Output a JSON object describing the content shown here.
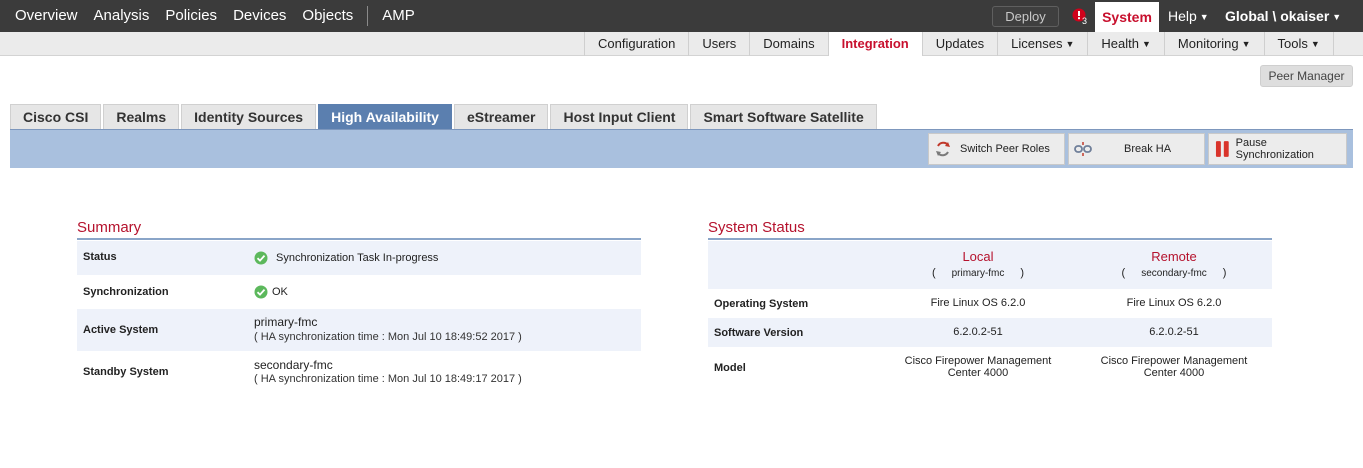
{
  "topnav": {
    "items": [
      "Overview",
      "Analysis",
      "Policies",
      "Devices",
      "Objects",
      "AMP"
    ],
    "deploy_label": "Deploy",
    "alert_count": "3",
    "system_label": "System",
    "help_label": "Help",
    "user_label": "Global \\ okaiser"
  },
  "subnav": {
    "items": [
      "Configuration",
      "Users",
      "Domains",
      "Integration",
      "Updates",
      "Licenses",
      "Health",
      "Monitoring",
      "Tools"
    ],
    "active": "Integration",
    "dropdowns": [
      "Licenses",
      "Health",
      "Monitoring",
      "Tools"
    ]
  },
  "peer_manager_label": "Peer Manager",
  "tabs": {
    "items": [
      "Cisco CSI",
      "Realms",
      "Identity Sources",
      "High Availability",
      "eStreamer",
      "Host Input Client",
      "Smart Software Satellite"
    ],
    "active": "High Availability"
  },
  "toolbar": {
    "switch_peer_roles": "Switch Peer Roles",
    "break_ha": "Break HA",
    "pause_sync": "Pause Synchronization"
  },
  "summary": {
    "title": "Summary",
    "status_label": "Status",
    "status_value": "Synchronization Task In-progress",
    "sync_label": "Synchronization",
    "sync_value": "OK",
    "active_label": "Active System",
    "active_host": "primary-fmc",
    "active_sync_time": "( HA synchronization time : Mon Jul 10 18:49:52 2017 )",
    "standby_label": "Standby System",
    "standby_host": "secondary-fmc",
    "standby_sync_time": "( HA synchronization time : Mon Jul 10 18:49:17 2017 )"
  },
  "system_status": {
    "title": "System Status",
    "local_title": "Local",
    "local_host": "primary-fmc",
    "remote_title": "Remote",
    "remote_host": "secondary-fmc",
    "os_label": "Operating System",
    "os_local": "Fire Linux OS 6.2.0",
    "os_remote": "Fire Linux OS 6.2.0",
    "sw_label": "Software Version",
    "sw_local": "6.2.0.2-51",
    "sw_remote": "6.2.0.2-51",
    "model_label": "Model",
    "model_local_line1": "Cisco Firepower Management",
    "model_local_line2": "Center 4000",
    "model_remote_line1": "Cisco Firepower Management",
    "model_remote_line2": "Center 4000"
  },
  "colors": {
    "accent_red": "#c8102e",
    "active_tab_blue": "#5b7faf",
    "toolbar_band": "#a9c0de",
    "ok_green": "#5cb85c"
  }
}
